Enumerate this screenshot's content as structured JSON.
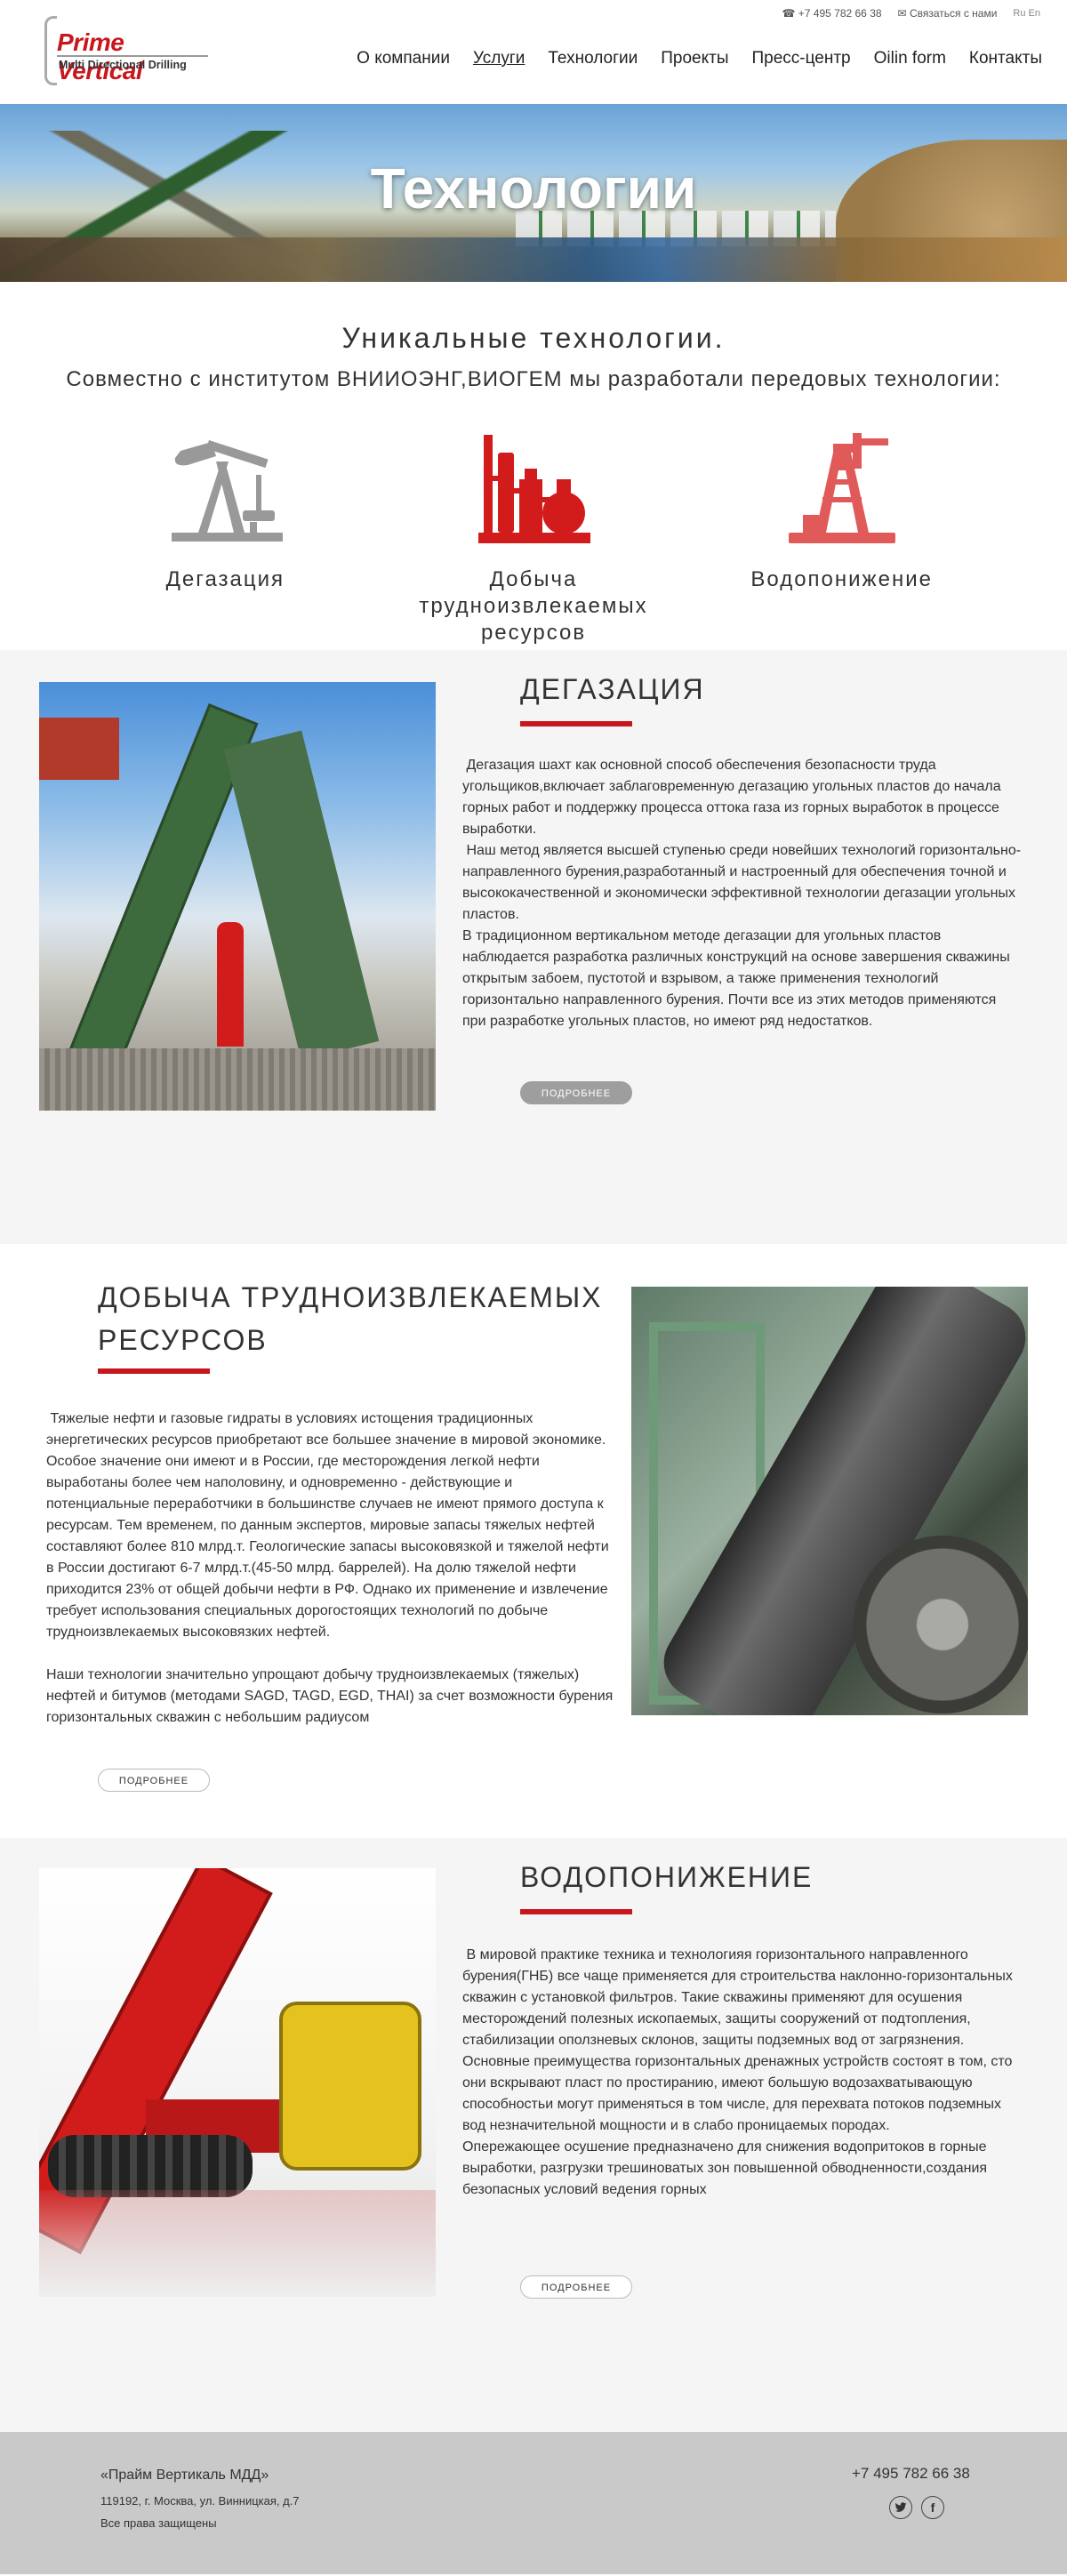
{
  "header": {
    "logo_title": "Prime Vertical",
    "logo_subtitle": "Multi Directional Drilling",
    "phone": "+7 495 782 66 38",
    "contact_link": "Связаться с нами",
    "langs": "Ru En",
    "nav": [
      "О компании",
      "Услуги",
      "Технологии",
      "Проекты",
      "Пресс-центр",
      "Oilin form",
      "Контакты"
    ],
    "active_nav": "Услуги"
  },
  "hero": {
    "title": "Технологии"
  },
  "intro": {
    "heading": "Уникальные технологии.",
    "lead": "Совместно с институтом ВНИИОЭНГ,ВИОГЕМ мы разработали передовых технологии:",
    "features": [
      {
        "label": "Дегазация",
        "icon": "pumpjack-icon",
        "color": "#999999"
      },
      {
        "label": "Добыча трудноизвлекаемых ресурсов",
        "icon": "refinery-icon",
        "color": "#d21c1c"
      },
      {
        "label": "Водопонижение",
        "icon": "oil-derrick-icon",
        "color": "#e05a5a"
      }
    ]
  },
  "sections": [
    {
      "title": "ДЕГАЗАЦИЯ",
      "text": " Дегазация шахт как основной способ обеспечения безопасности труда угольщиков,включает заблаговременную дегазацию угольных пластов до начала горных работ и поддержку процесса оттока газа из горных выработок в процессе выработки.\n Наш метод является высшей ступенью среди новейших технологий горизонтально-направленного бурения,разработанный и настроенный для обеспечения точной и высококачественной и экономически эффективной технологии дегазации угольных пластов.\nВ традиционном вертикальном методе дегазации для угольных пластов наблюдается разработка различных конструкций на основе завершения скважины открытым забоем, пустотой и взрывом, а также применения технологий горизонтально направленного бурения. Почти все из этих методов применяются при разработке угольных пластов, но имеют ряд недостатков.",
      "button": "ПОДРОБНЕЕ"
    },
    {
      "title": "ДОБЫЧА ТРУДНОИЗВЛЕКАЕМЫХ РЕСУРСОВ",
      "text": " Тяжелые нефти и газовые гидраты в условиях истощения традиционных энергетических ресурсов приобретают все большее значение в мировой экономике. Особое значение они имеют и в России, где месторождения легкой нефти выработаны более чем наполовину, и одновременно - действующие и потенциальные переработчики в большинстве случаев не имеют прямого доступа к ресурсам. Тем временем, по данным экспертов, мировые запасы тяжелых нефтей составляют более 810 млрд.т. Геологические запасы высоковязкой и тяжелой нефти в России достигают 6-7 млрд.т.(45-50 млрд. баррелей). На долю тяжелой нефти приходится 23% от общей добычи нефти в РФ. Однако их применение и извлечение требует использования специальных дорогостоящих технологий по добыче трудноизвлекаемых высоковязких нефтей.\n\nНаши технологии значительно упрощают добычу трудноизвлекаемых (тяжелых) нефтей и битумов (методами SAGD, TAGD, EGD, THAI) за счет возможности бурения горизонтальных скважин с небольшим радиусом",
      "button": "ПОДРОБНЕЕ"
    },
    {
      "title": "ВОДОПОНИЖЕНИЕ",
      "text": " В мировой практике техника и технологияя горизонтального направленного бурения(ГНБ) все чаще применяется для строительства наклонно-горизонтальных скважин с установкой фильтров. Такие скважины применяют для осушения месторождений полезных ископаемых, защиты сооружений от подтопления, стабилизации оползневых склонов, защиты подземных вод от загрязнения.\nОсновные преимущества горизонтальных дренажных устройств состоят в том, сто они вскрывают пласт по простиранию, имеют большую водозахватывающую способностьи могут применяться в том числе, для перехвата потоков подземных вод незначительной мощности и в слабо проницаемых породах.\nОпережающее осушение предназначено для снижения водопритоков в горные выработки, разгрузки трешиноватых зон повышенной обводненности,создания безопасных условий ведения горных",
      "button": "ПОДРОБНЕЕ"
    }
  ],
  "footer": {
    "company": "«Прайм Вертикаль МДД»",
    "address": "119192, г. Москва, ул. Винницкая, д.7",
    "rights": "Все права защищены",
    "phone": "+7 495 782 66 38",
    "social": [
      "twitter-icon",
      "facebook-icon"
    ]
  }
}
